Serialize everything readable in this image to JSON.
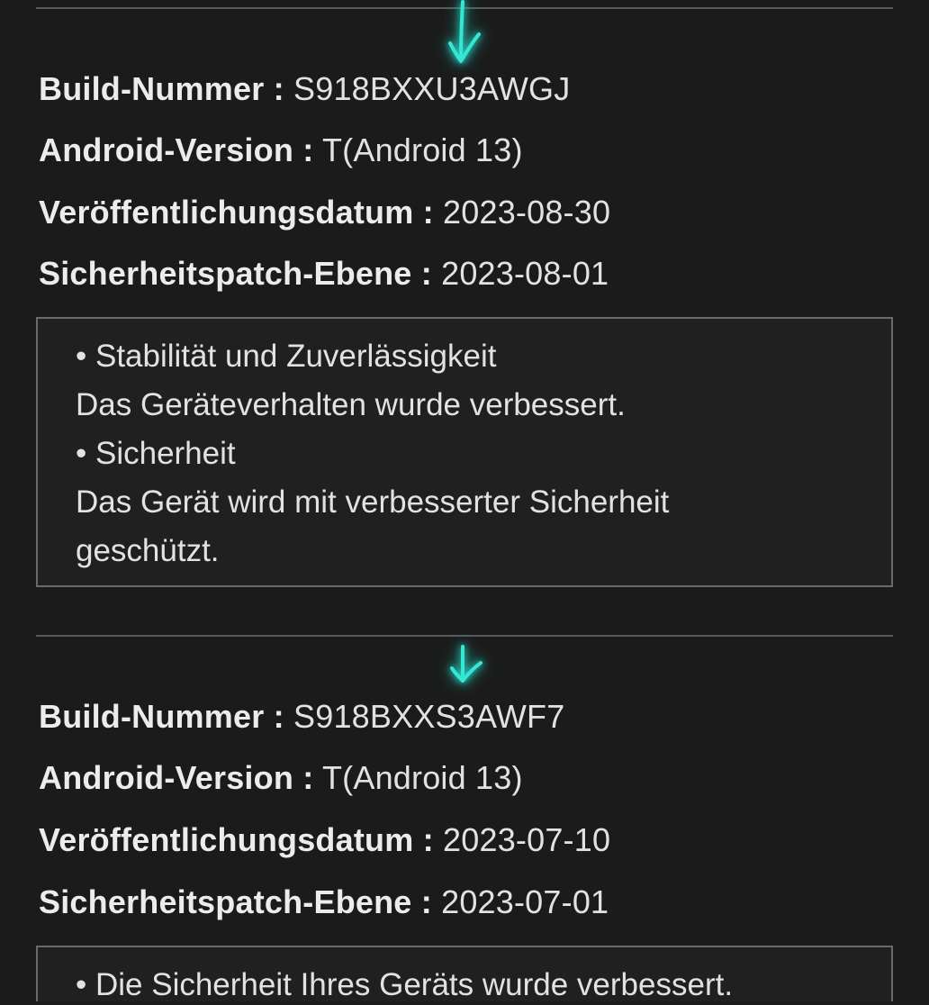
{
  "entries": [
    {
      "build_label": "Build-Nummer :",
      "build_value": "S918BXXU3AWGJ",
      "android_label": "Android-Version :",
      "android_value": "T(Android 13)",
      "release_label": "Veröffentlichungsdatum :",
      "release_value": "2023-08-30",
      "patch_label": "Sicherheitspatch-Ebene :",
      "patch_value": "2023-08-01",
      "notes": [
        "• Stabilität und Zuverlässigkeit",
        "Das Geräteverhalten wurde verbessert.",
        "• Sicherheit",
        "Das Gerät wird mit verbesserter Sicherheit",
        "geschützt."
      ]
    },
    {
      "build_label": "Build-Nummer :",
      "build_value": "S918BXXS3AWF7",
      "android_label": "Android-Version :",
      "android_value": "T(Android 13)",
      "release_label": "Veröffentlichungsdatum :",
      "release_value": "2023-07-10",
      "patch_label": "Sicherheitspatch-Ebene :",
      "patch_value": "2023-07-01",
      "notes": [
        "• Die Sicherheit Ihres Geräts wurde verbessert."
      ]
    }
  ],
  "annotation_color": "#35e6d4"
}
